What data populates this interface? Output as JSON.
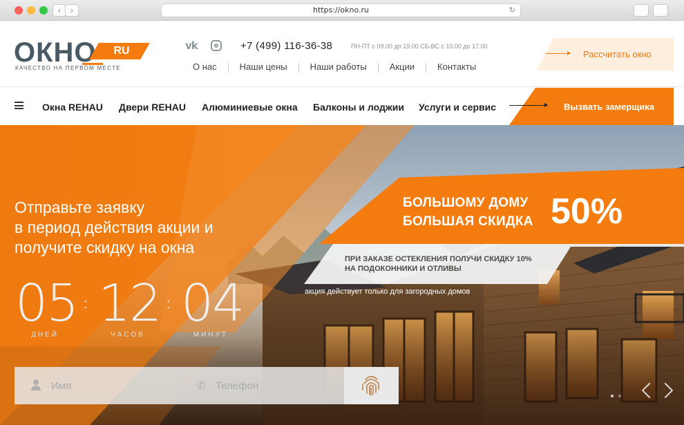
{
  "browser": {
    "url": "https://okno.ru"
  },
  "header": {
    "logo_text": "ОКНО",
    "logo_suffix": "RU",
    "tagline": "качество на первом месте",
    "phone": "+7 (499) 116-36-38",
    "hours": "ПН-ПТ с 09.00 до 19.00 СБ-ВС с 10.00 до 17.00",
    "nav": [
      "О нас",
      "Наши цены",
      "Наши работы",
      "Акции",
      "Контакты"
    ],
    "calc_button": "Рассчитать окно"
  },
  "mainnav": {
    "items": [
      "Окна REHAU",
      "Двери REHAU",
      "Алюминиевые окна",
      "Балконы и лоджии",
      "Услуги и сервис"
    ],
    "cta": "Вызвать замерщика"
  },
  "hero": {
    "title_lines": [
      "Отправьте заявку",
      "в период действия акции и",
      "получите скидку на окна"
    ],
    "countdown": {
      "days": "05",
      "hours": "12",
      "minutes": "04",
      "days_label": "дней",
      "hours_label": "часов",
      "minutes_label": "минут"
    },
    "banner_line1": "Большому дому",
    "banner_line2": "большая скидка",
    "banner_percent": "50%",
    "sub_line1": "ПРИ ЗАКАЗЕ ОСТЕКЛЕНИЯ ПОЛУЧИ СКИДКУ 10%",
    "sub_line2": "НА ПОДОКОННИКИ И ОТЛИВЫ",
    "note": "акция действует только для загородных домов",
    "form": {
      "name_placeholder": "Имя",
      "phone_placeholder": "Телефон"
    }
  },
  "colors": {
    "accent": "#f47b0e",
    "logo": "#4a5a64"
  }
}
